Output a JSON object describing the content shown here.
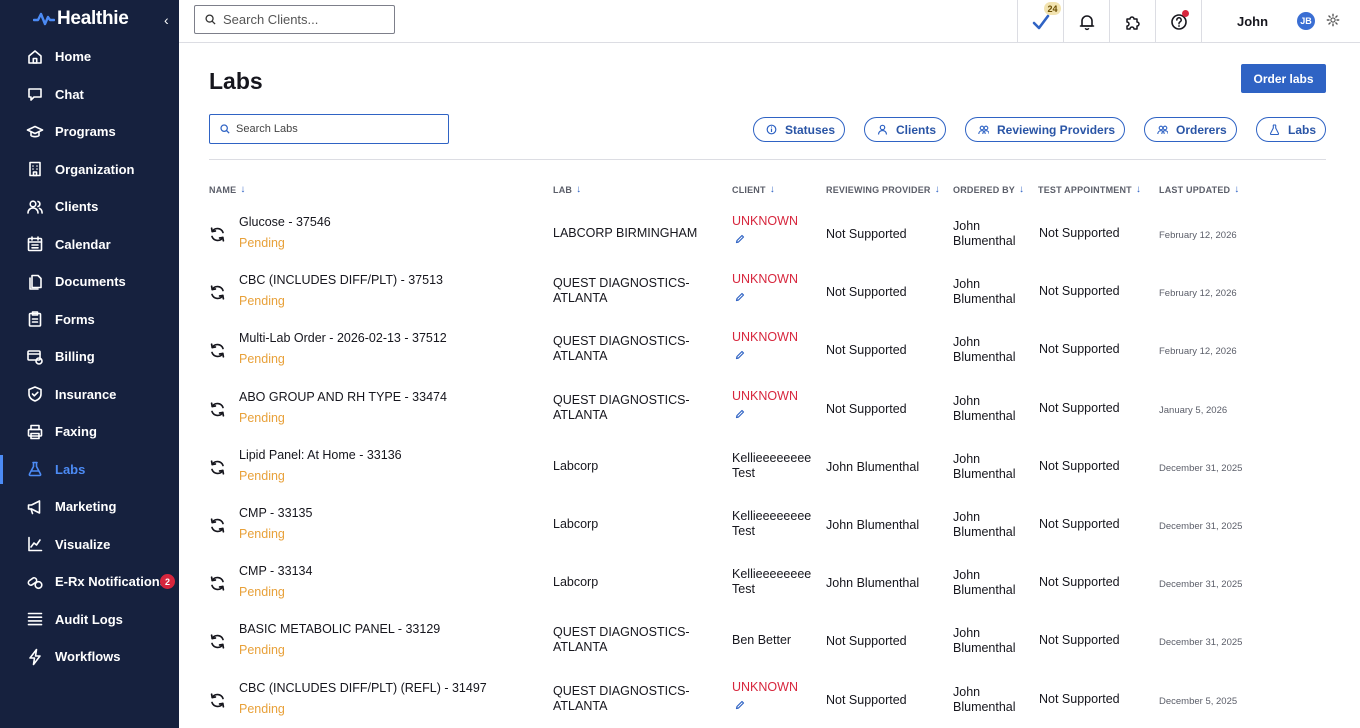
{
  "brand": {
    "name": "Healthie"
  },
  "sidebar": {
    "items": [
      {
        "label": "Home",
        "icon": "home-icon"
      },
      {
        "label": "Chat",
        "icon": "chat-icon"
      },
      {
        "label": "Programs",
        "icon": "graduation-cap-icon"
      },
      {
        "label": "Organization",
        "icon": "building-icon"
      },
      {
        "label": "Clients",
        "icon": "users-icon"
      },
      {
        "label": "Calendar",
        "icon": "calendar-icon"
      },
      {
        "label": "Documents",
        "icon": "documents-icon"
      },
      {
        "label": "Forms",
        "icon": "clipboard-icon"
      },
      {
        "label": "Billing",
        "icon": "billing-icon"
      },
      {
        "label": "Insurance",
        "icon": "shield-icon"
      },
      {
        "label": "Faxing",
        "icon": "printer-icon"
      },
      {
        "label": "Labs",
        "icon": "flask-icon",
        "active": true
      },
      {
        "label": "Marketing",
        "icon": "megaphone-icon"
      },
      {
        "label": "Visualize",
        "icon": "chart-icon"
      },
      {
        "label": "E-Rx Notifications",
        "icon": "pills-icon",
        "badge": "2"
      },
      {
        "label": "Audit Logs",
        "icon": "list-icon"
      },
      {
        "label": "Workflows",
        "icon": "bolt-icon"
      }
    ]
  },
  "topbar": {
    "search_placeholder": "Search Clients...",
    "task_count": "24",
    "user_name": "John",
    "user_initials": "JB"
  },
  "page": {
    "title": "Labs",
    "order_button": "Order labs",
    "search_placeholder": "Search Labs",
    "filters": [
      "Statuses",
      "Clients",
      "Reviewing Providers",
      "Orderers",
      "Labs"
    ]
  },
  "table": {
    "columns": [
      "NAME",
      "LAB",
      "CLIENT",
      "REVIEWING PROVIDER",
      "ORDERED BY",
      "TEST APPOINTMENT",
      "LAST UPDATED"
    ],
    "rows": [
      {
        "name": "Glucose - 37546",
        "status": "Pending",
        "lab": "LABCORP BIRMINGHAM",
        "client": "UNKNOWN",
        "client_unknown": true,
        "provider": "Not Supported",
        "ordered_by": "John Blumenthal",
        "appointment": "Not Supported",
        "updated": "February 12, 2026"
      },
      {
        "name": "CBC (INCLUDES DIFF/PLT) - 37513",
        "status": "Pending",
        "lab": "QUEST DIAGNOSTICS-ATLANTA",
        "client": "UNKNOWN",
        "client_unknown": true,
        "provider": "Not Supported",
        "ordered_by": "John Blumenthal",
        "appointment": "Not Supported",
        "updated": "February 12, 2026"
      },
      {
        "name": "Multi-Lab Order - 2026-02-13 - 37512",
        "status": "Pending",
        "lab": "QUEST DIAGNOSTICS-ATLANTA",
        "client": "UNKNOWN",
        "client_unknown": true,
        "provider": "Not Supported",
        "ordered_by": "John Blumenthal",
        "appointment": "Not Supported",
        "updated": "February 12, 2026"
      },
      {
        "name": "ABO GROUP AND RH TYPE - 33474",
        "status": "Pending",
        "lab": "QUEST DIAGNOSTICS-ATLANTA",
        "client": "UNKNOWN",
        "client_unknown": true,
        "provider": "Not Supported",
        "ordered_by": "John Blumenthal",
        "appointment": "Not Supported",
        "updated": "January 5, 2026"
      },
      {
        "name": "Lipid Panel: At Home - 33136",
        "status": "Pending",
        "lab": "Labcorp",
        "client": "Kellieeeeeeee Test",
        "client_unknown": false,
        "provider": "John Blumenthal",
        "ordered_by": "John Blumenthal",
        "appointment": "Not Supported",
        "updated": "December 31, 2025"
      },
      {
        "name": "CMP - 33135",
        "status": "Pending",
        "lab": "Labcorp",
        "client": "Kellieeeeeeee Test",
        "client_unknown": false,
        "provider": "John Blumenthal",
        "ordered_by": "John Blumenthal",
        "appointment": "Not Supported",
        "updated": "December 31, 2025"
      },
      {
        "name": "CMP - 33134",
        "status": "Pending",
        "lab": "Labcorp",
        "client": "Kellieeeeeeee Test",
        "client_unknown": false,
        "provider": "John Blumenthal",
        "ordered_by": "John Blumenthal",
        "appointment": "Not Supported",
        "updated": "December 31, 2025"
      },
      {
        "name": "BASIC METABOLIC PANEL - 33129",
        "status": "Pending",
        "lab": "QUEST DIAGNOSTICS-ATLANTA",
        "client": "Ben Better",
        "client_unknown": false,
        "provider": "Not Supported",
        "ordered_by": "John Blumenthal",
        "appointment": "Not Supported",
        "updated": "December 31, 2025"
      },
      {
        "name": "CBC (INCLUDES DIFF/PLT) (REFL) - 31497",
        "status": "Pending",
        "lab": "QUEST DIAGNOSTICS-ATLANTA",
        "client": "UNKNOWN",
        "client_unknown": true,
        "provider": "Not Supported",
        "ordered_by": "John Blumenthal",
        "appointment": "Not Supported",
        "updated": "December 5, 2025"
      }
    ]
  },
  "colors": {
    "sidebar_bg": "#16213e",
    "accent": "#2f63c4",
    "active_nav": "#4c8bf5",
    "pending": "#e8a13a",
    "unknown": "#d7263d"
  }
}
